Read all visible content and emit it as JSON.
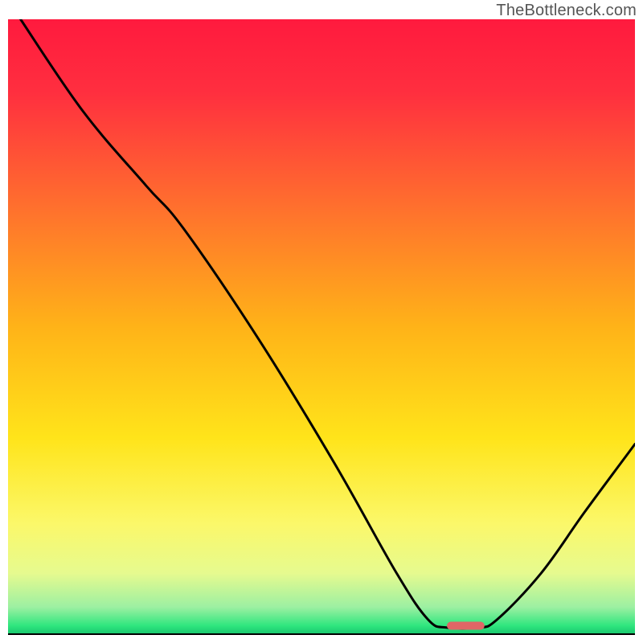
{
  "watermark": "TheBottleneck.com",
  "chart_data": {
    "type": "line",
    "title": "",
    "xlabel": "",
    "ylabel": "",
    "xlim": [
      0,
      100
    ],
    "ylim": [
      0,
      100
    ],
    "grid": false,
    "legend": false,
    "background_gradient_stops": [
      {
        "offset": 0.0,
        "color": "#ff1a3e"
      },
      {
        "offset": 0.12,
        "color": "#ff2f3f"
      },
      {
        "offset": 0.3,
        "color": "#ff6e2e"
      },
      {
        "offset": 0.5,
        "color": "#ffb318"
      },
      {
        "offset": 0.68,
        "color": "#ffe41a"
      },
      {
        "offset": 0.82,
        "color": "#fbf86a"
      },
      {
        "offset": 0.9,
        "color": "#e6fa8f"
      },
      {
        "offset": 0.955,
        "color": "#9cf0a2"
      },
      {
        "offset": 0.985,
        "color": "#2fe67e"
      },
      {
        "offset": 1.0,
        "color": "#16c36c"
      }
    ],
    "series": [
      {
        "name": "bottleneck-curve",
        "stroke": "#000000",
        "points": [
          {
            "x": 2,
            "y": 100
          },
          {
            "x": 12,
            "y": 85
          },
          {
            "x": 22,
            "y": 73
          },
          {
            "x": 28,
            "y": 66
          },
          {
            "x": 40,
            "y": 48
          },
          {
            "x": 52,
            "y": 28
          },
          {
            "x": 62,
            "y": 10
          },
          {
            "x": 67,
            "y": 2.5
          },
          {
            "x": 70,
            "y": 1.2
          },
          {
            "x": 75,
            "y": 1.2
          },
          {
            "x": 78,
            "y": 2.5
          },
          {
            "x": 85,
            "y": 10
          },
          {
            "x": 92,
            "y": 20
          },
          {
            "x": 100,
            "y": 31
          }
        ]
      }
    ],
    "marker": {
      "name": "optimal-range",
      "x_start": 70,
      "x_end": 76,
      "y": 1.5,
      "color": "#e06666"
    },
    "axis": {
      "show_xaxis_line": true,
      "xaxis_color": "#000000"
    }
  }
}
